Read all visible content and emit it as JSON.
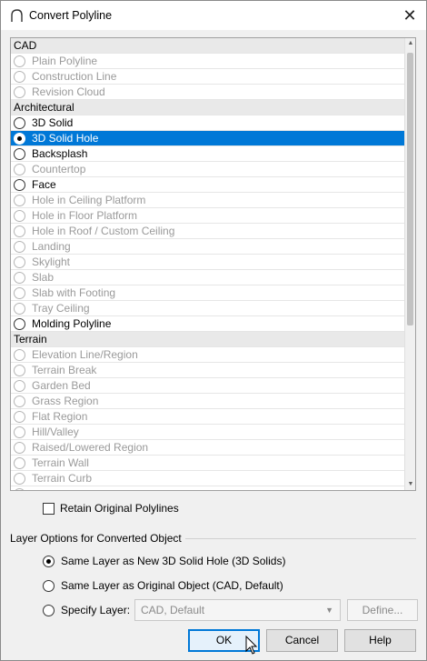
{
  "window": {
    "title": "Convert Polyline",
    "close_glyph": "✕"
  },
  "list": {
    "rows": [
      {
        "type": "header",
        "label": "CAD"
      },
      {
        "type": "item",
        "label": "Plain Polyline",
        "state": "disabled"
      },
      {
        "type": "item",
        "label": "Construction Line",
        "state": "disabled"
      },
      {
        "type": "item",
        "label": "Revision Cloud",
        "state": "disabled"
      },
      {
        "type": "header",
        "label": "Architectural"
      },
      {
        "type": "item",
        "label": "3D Solid",
        "state": "enabled"
      },
      {
        "type": "item",
        "label": "3D Solid Hole",
        "state": "selected"
      },
      {
        "type": "item",
        "label": "Backsplash",
        "state": "enabled"
      },
      {
        "type": "item",
        "label": "Countertop",
        "state": "disabled"
      },
      {
        "type": "item",
        "label": "Face",
        "state": "enabled"
      },
      {
        "type": "item",
        "label": "Hole in Ceiling Platform",
        "state": "disabled"
      },
      {
        "type": "item",
        "label": "Hole in Floor Platform",
        "state": "disabled"
      },
      {
        "type": "item",
        "label": "Hole in Roof / Custom Ceiling",
        "state": "disabled"
      },
      {
        "type": "item",
        "label": "Landing",
        "state": "disabled"
      },
      {
        "type": "item",
        "label": "Skylight",
        "state": "disabled"
      },
      {
        "type": "item",
        "label": "Slab",
        "state": "disabled"
      },
      {
        "type": "item",
        "label": "Slab with Footing",
        "state": "disabled"
      },
      {
        "type": "item",
        "label": "Tray Ceiling",
        "state": "disabled"
      },
      {
        "type": "item",
        "label": "Molding Polyline",
        "state": "enabled"
      },
      {
        "type": "header",
        "label": "Terrain"
      },
      {
        "type": "item",
        "label": "Elevation Line/Region",
        "state": "disabled"
      },
      {
        "type": "item",
        "label": "Terrain Break",
        "state": "disabled"
      },
      {
        "type": "item",
        "label": "Garden Bed",
        "state": "disabled"
      },
      {
        "type": "item",
        "label": "Grass Region",
        "state": "disabled"
      },
      {
        "type": "item",
        "label": "Flat Region",
        "state": "disabled"
      },
      {
        "type": "item",
        "label": "Hill/Valley",
        "state": "disabled"
      },
      {
        "type": "item",
        "label": "Raised/Lowered Region",
        "state": "disabled"
      },
      {
        "type": "item",
        "label": "Terrain Wall",
        "state": "disabled"
      },
      {
        "type": "item",
        "label": "Terrain Curb",
        "state": "disabled"
      },
      {
        "type": "item",
        "label": "",
        "state": "disabled"
      }
    ]
  },
  "retain": {
    "label": "Retain Original Polylines",
    "checked": false
  },
  "layer_options": {
    "title": "Layer Options for Converted Object",
    "option_same_new": "Same Layer as New 3D Solid Hole (3D Solids)",
    "option_same_original": "Same Layer as Original Object (CAD,  Default)",
    "option_specify": "Specify Layer:",
    "selected_index": 0,
    "layer_value": "CAD,  Default",
    "define_label": "Define..."
  },
  "buttons": {
    "ok": "OK",
    "cancel": "Cancel",
    "help": "Help"
  },
  "colors": {
    "selection": "#0078d7",
    "disabled_text": "#9a9a9a",
    "header_bg": "#e9e9e9"
  }
}
